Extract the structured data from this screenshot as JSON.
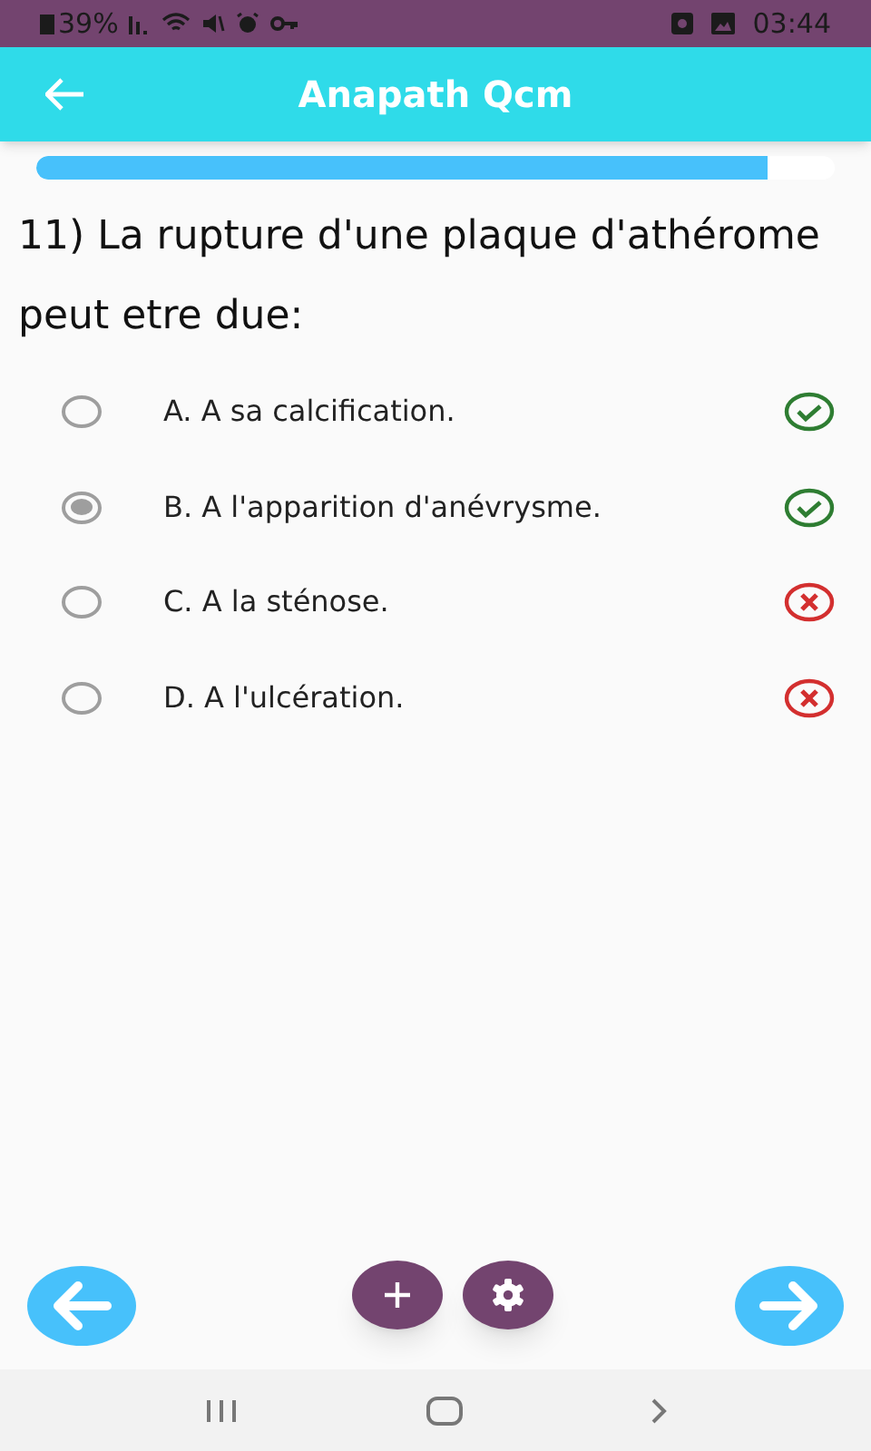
{
  "status_bar": {
    "battery": "39%",
    "time": "03:44"
  },
  "app_bar": {
    "title": "Anapath Qcm"
  },
  "progress": {
    "level": 0.915
  },
  "question": "11) La rupture d'une plaque d'athérome peut etre due:",
  "options": [
    {
      "label": "A. A sa calcification.",
      "selected": false,
      "correct": true
    },
    {
      "label": "B. A l'apparition d'anévrysme.",
      "selected": true,
      "correct": true
    },
    {
      "label": "C. A la sténose.",
      "selected": false,
      "correct": false
    },
    {
      "label": "D. A l'ulcération.",
      "selected": false,
      "correct": false
    }
  ]
}
